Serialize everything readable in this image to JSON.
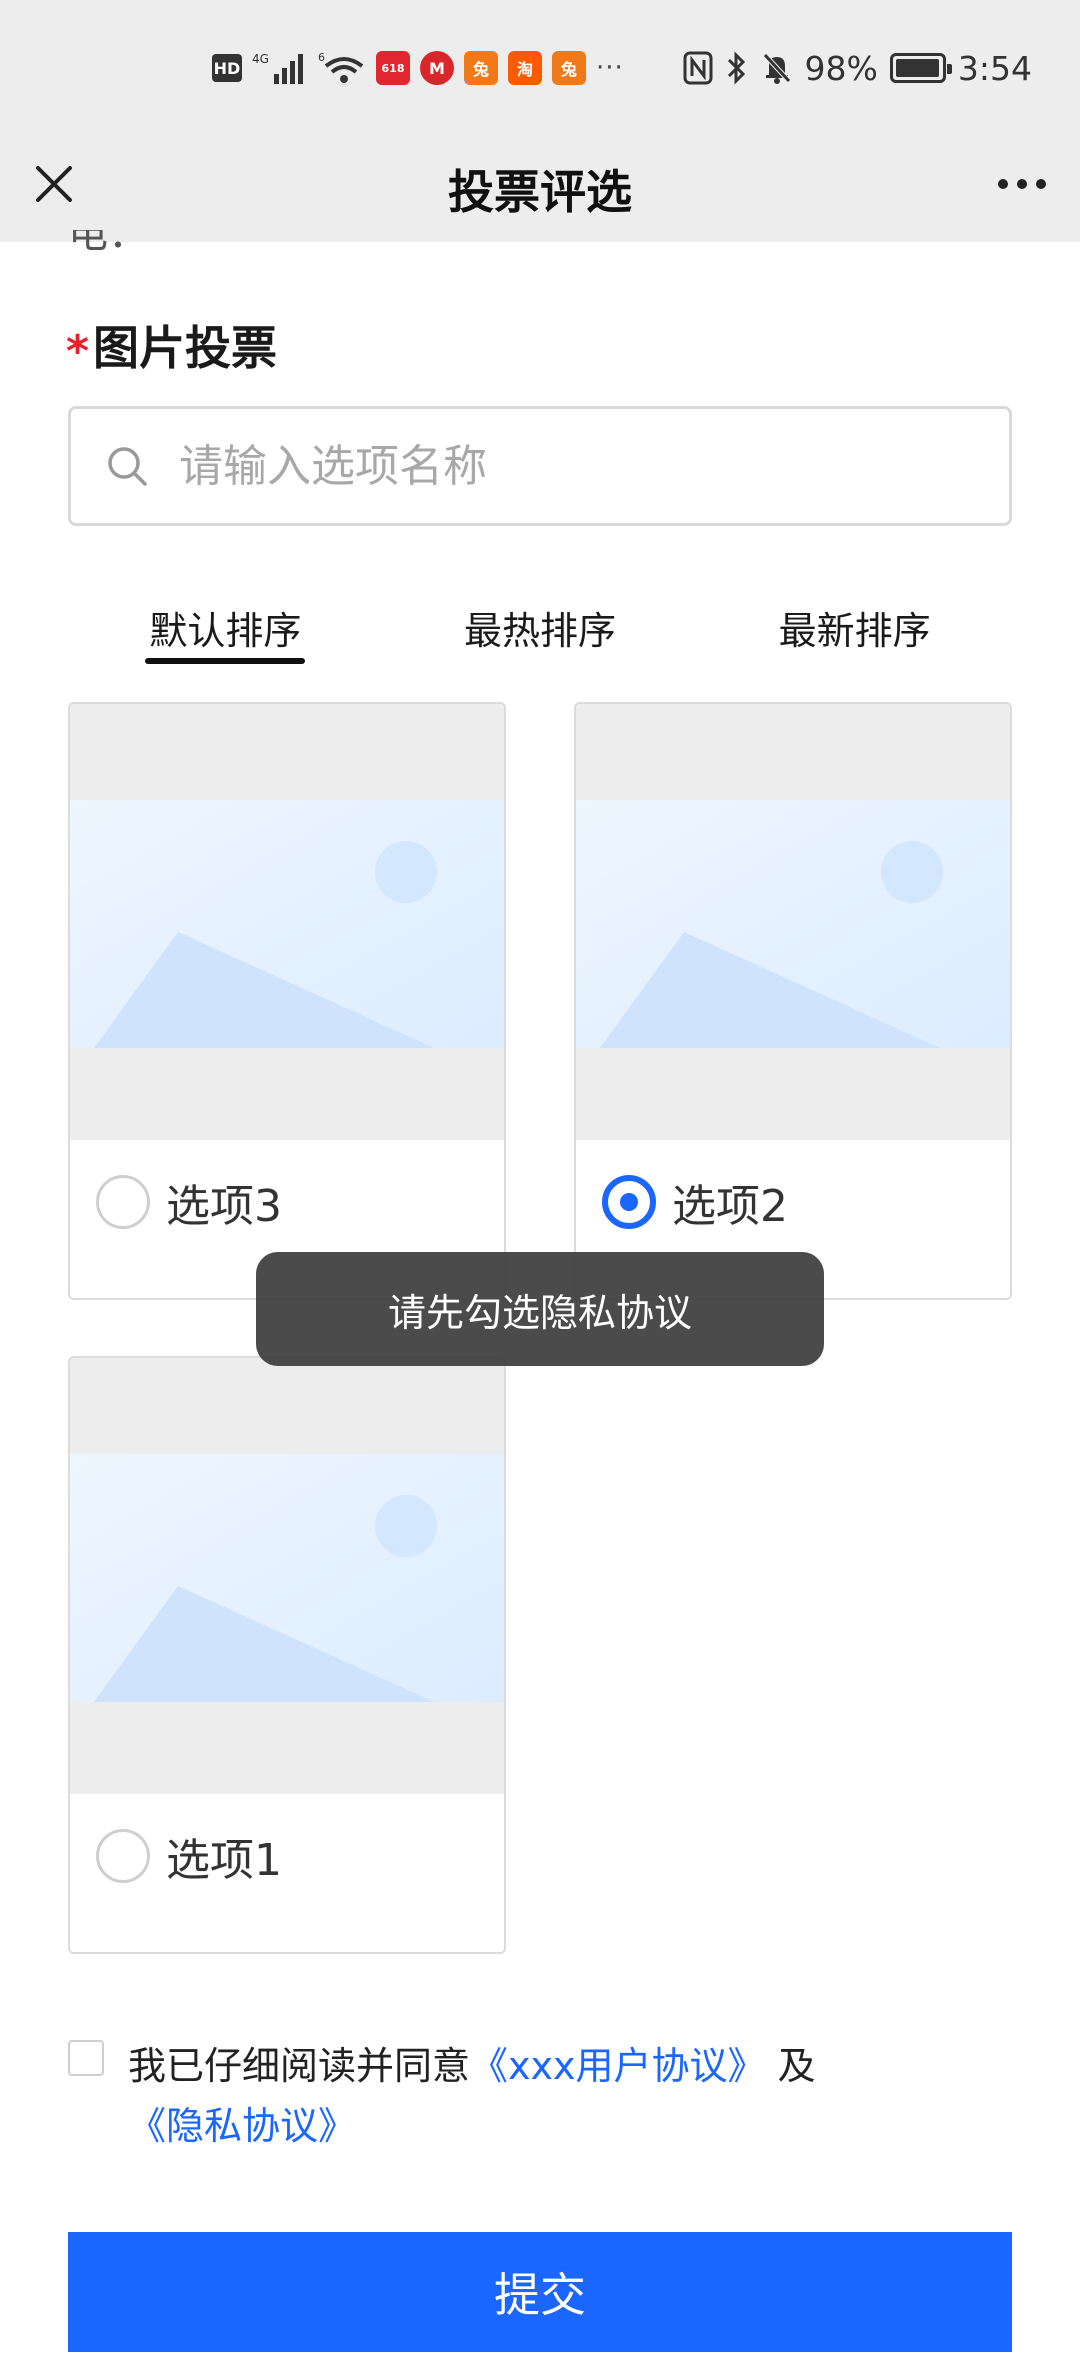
{
  "status_bar": {
    "hd_label": "HD",
    "network_label": "4G",
    "network_sub": "6",
    "more_label": "···",
    "battery_text": "98%",
    "battery_level": 0.98,
    "time": "3:54",
    "app_badges": [
      {
        "icon": "app-icon-1",
        "text": "618",
        "color": "#e0262e"
      },
      {
        "icon": "app-icon-2",
        "text": "M",
        "color": "#d8262a"
      },
      {
        "icon": "app-icon-3",
        "text": "兔",
        "color": "#f07a1a"
      },
      {
        "icon": "taobao-icon",
        "text": "淘",
        "color": "#ff5a00"
      },
      {
        "icon": "app-icon-5",
        "text": "兔",
        "color": "#f07a1a"
      }
    ]
  },
  "nav": {
    "title": "投票评选",
    "close_icon": "close-icon",
    "more_icon": "more-icon"
  },
  "clipped_text": "电：",
  "section": {
    "required_mark": "*",
    "title": "图片投票"
  },
  "search": {
    "placeholder": "请输入选项名称",
    "value": ""
  },
  "sort_tabs": [
    {
      "label": "默认排序",
      "active": true
    },
    {
      "label": "最热排序",
      "active": false
    },
    {
      "label": "最新排序",
      "active": false
    }
  ],
  "options": [
    {
      "label": "选项3",
      "checked": false
    },
    {
      "label": "选项2",
      "checked": true
    },
    {
      "label": "选项1",
      "checked": false
    }
  ],
  "toast": {
    "text": "请先勾选隐私协议"
  },
  "agreement": {
    "checked": false,
    "prefix": "我已仔细阅读并同意",
    "user_agreement": "《xxx用户协议》",
    "conjunction": "及",
    "privacy_agreement": "《隐私协议》"
  },
  "submit": {
    "label": "提交"
  },
  "colors": {
    "accent": "#1a66ff",
    "required": "#e8202a",
    "toast_bg": "#3c3c3c"
  }
}
